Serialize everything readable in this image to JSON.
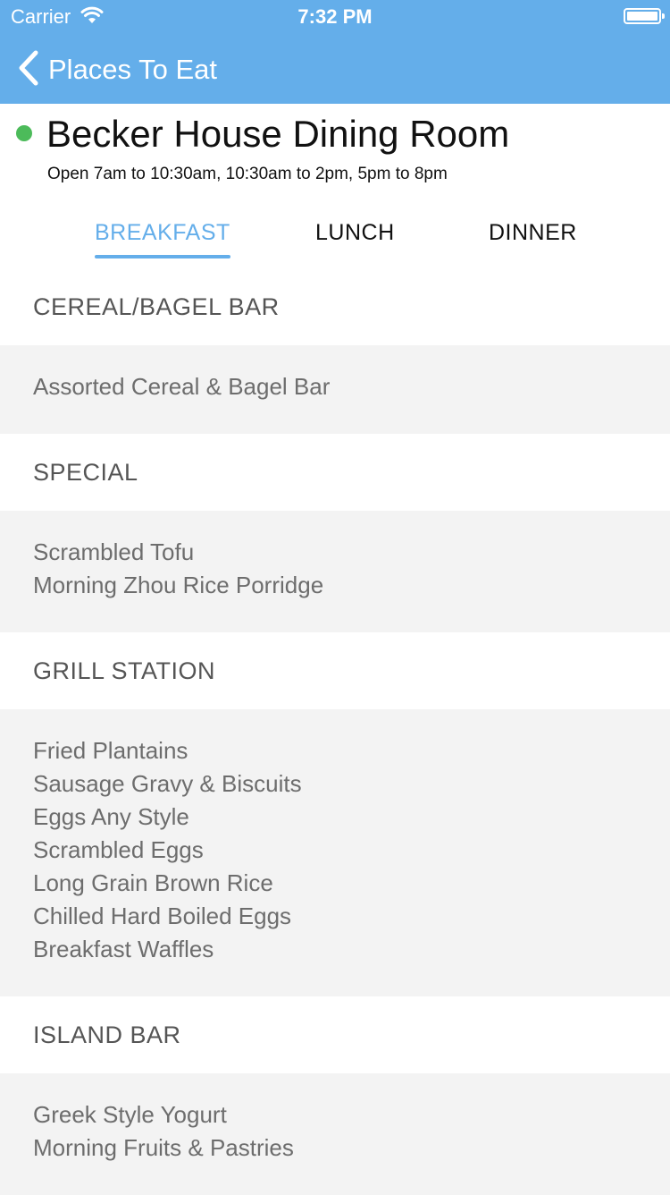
{
  "status_bar": {
    "carrier": "Carrier",
    "time": "7:32 PM"
  },
  "nav": {
    "back_label": "Places To Eat"
  },
  "place": {
    "name": "Becker House Dining Room",
    "hours": "Open 7am to 10:30am, 10:30am to 2pm, 5pm to 8pm",
    "open_indicator_color": "#4cbb5a"
  },
  "tabs": [
    {
      "label": "BREAKFAST",
      "active": true
    },
    {
      "label": "LUNCH",
      "active": false
    },
    {
      "label": "DINNER",
      "active": false
    }
  ],
  "sections": [
    {
      "title": "CEREAL/BAGEL BAR",
      "items": [
        "Assorted Cereal & Bagel Bar"
      ]
    },
    {
      "title": "SPECIAL",
      "items": [
        "Scrambled Tofu",
        "Morning Zhou Rice Porridge"
      ]
    },
    {
      "title": "GRILL STATION",
      "items": [
        "Fried Plantains",
        "Sausage Gravy & Biscuits",
        "Eggs Any Style",
        "Scrambled Eggs",
        "Long Grain Brown Rice",
        "Chilled Hard Boiled Eggs",
        "Breakfast Waffles"
      ]
    },
    {
      "title": "ISLAND BAR",
      "items": [
        "Greek Style Yogurt",
        "Morning Fruits & Pastries"
      ]
    }
  ],
  "colors": {
    "accent": "#64aeea",
    "section_bg": "#f3f3f3"
  }
}
